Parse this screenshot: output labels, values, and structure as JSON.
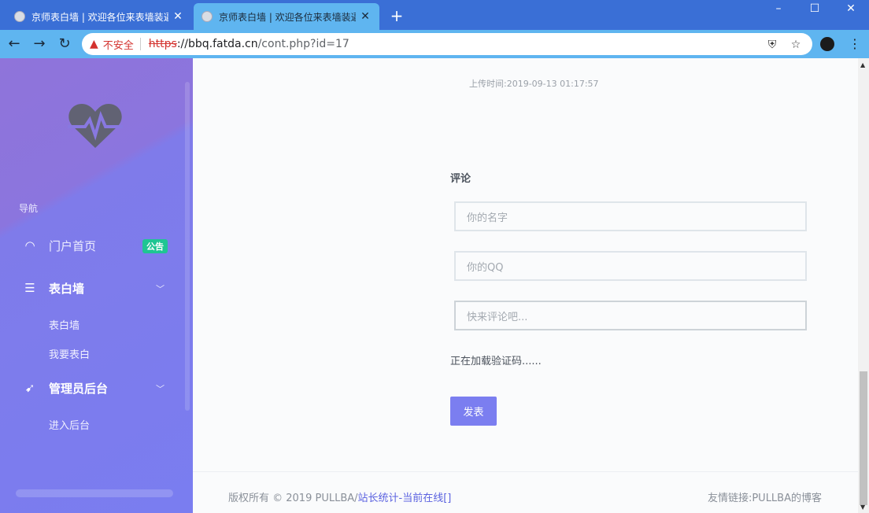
{
  "browser": {
    "tabs": [
      {
        "title": "京师表白墙 | 欢迎各位来表墙装逼",
        "active": false
      },
      {
        "title": "京师表白墙 | 欢迎各位来表墙装逼",
        "active": true
      }
    ],
    "new_tab": "+",
    "window": {
      "minimize": "–",
      "maximize": "☐",
      "close": "✕"
    },
    "nav": {
      "back": "←",
      "forward": "→",
      "reload": "↻"
    },
    "address": {
      "warning_label": "不安全",
      "scheme": "https",
      "host": "://bbq.fatda.cn",
      "path": "/cont.php?id=17"
    }
  },
  "sidebar": {
    "heading": "导航",
    "items": [
      {
        "label": "门户首页",
        "icon": "gauge-icon",
        "badge": "公告"
      },
      {
        "label": "表白墙",
        "icon": "list-icon",
        "expanded": true
      },
      {
        "label": "管理员后台",
        "icon": "rocket-icon",
        "expanded": true
      }
    ],
    "sub_items_wall": [
      "表白墙",
      "我要表白"
    ],
    "sub_items_admin": [
      "进入后台"
    ]
  },
  "main": {
    "upload_time": "上传时间:2019-09-13 01:17:57",
    "comment_title": "评论",
    "name_placeholder": "你的名字",
    "qq_placeholder": "你的QQ",
    "comment_placeholder": "快来评论吧...",
    "captcha_status": "正在加载验证码......",
    "submit_label": "发表"
  },
  "footer": {
    "copyright_prefix": "版权所有 © 2019 PULLBA/",
    "stats_link": "站长统计",
    "online_link": "-当前在线[]",
    "friend_links": "友情链接:PULLBA的博客"
  },
  "colors": {
    "accent": "#7b7ef0",
    "badge": "#1fc593",
    "tabbar": "#3a6fd6",
    "toolbar": "#5fb5f0"
  }
}
